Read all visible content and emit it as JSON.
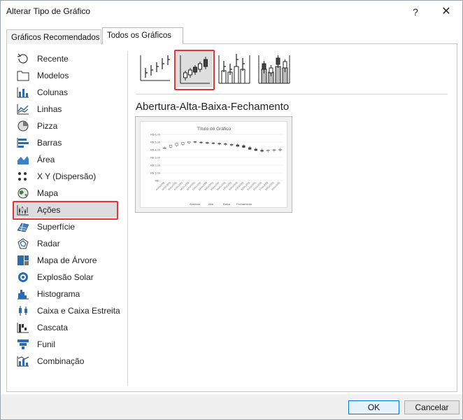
{
  "window": {
    "title": "Alterar Tipo de Gráfico",
    "help_label": "?",
    "close_label": "✕"
  },
  "tabs": [
    {
      "label": "Gráficos Recomendados",
      "active": false
    },
    {
      "label": "Todos os Gráficos",
      "active": true
    }
  ],
  "categories": [
    {
      "label": "Recente",
      "icon": "recent-icon"
    },
    {
      "label": "Modelos",
      "icon": "templates-icon"
    },
    {
      "label": "Colunas",
      "icon": "column-chart-icon"
    },
    {
      "label": "Linhas",
      "icon": "line-chart-icon"
    },
    {
      "label": "Pizza",
      "icon": "pie-chart-icon"
    },
    {
      "label": "Barras",
      "icon": "bar-chart-icon"
    },
    {
      "label": "Área",
      "icon": "area-chart-icon"
    },
    {
      "label": "X Y (Dispersão)",
      "icon": "scatter-chart-icon"
    },
    {
      "label": "Mapa",
      "icon": "map-chart-icon"
    },
    {
      "label": "Ações",
      "icon": "stock-chart-icon",
      "selected": true
    },
    {
      "label": "Superfície",
      "icon": "surface-chart-icon"
    },
    {
      "label": "Radar",
      "icon": "radar-chart-icon"
    },
    {
      "label": "Mapa de Árvore",
      "icon": "treemap-chart-icon"
    },
    {
      "label": "Explosão Solar",
      "icon": "sunburst-chart-icon"
    },
    {
      "label": "Histograma",
      "icon": "histogram-chart-icon"
    },
    {
      "label": "Caixa e Caixa Estreita",
      "icon": "box-whisker-chart-icon"
    },
    {
      "label": "Cascata",
      "icon": "waterfall-chart-icon"
    },
    {
      "label": "Funil",
      "icon": "funnel-chart-icon"
    },
    {
      "label": "Combinação",
      "icon": "combo-chart-icon"
    }
  ],
  "subtypes": [
    {
      "icon": "high-low-close-icon",
      "selected": false
    },
    {
      "icon": "open-high-low-close-icon",
      "selected": true
    },
    {
      "icon": "volume-high-low-close-icon",
      "selected": false
    },
    {
      "icon": "volume-open-high-low-close-icon",
      "selected": false
    }
  ],
  "selected_subtype_name": "Abertura-Alta-Baixa-Fechamento",
  "preview": {
    "chart_data": {
      "type": "candlestick",
      "title": "Título do Gráfico",
      "y_tick_labels": [
        "R$ 6,00",
        "R$ 5,00",
        "R$ 4,00",
        "R$ 3,00",
        "R$ 2,00",
        "R$ 1,00",
        "R$ -"
      ],
      "ylim": [
        0,
        6
      ],
      "categories": [
        "04/01/2021",
        "05/01/2021",
        "06/01/2021",
        "07/01/2021",
        "08/01/2021",
        "11/01/2021",
        "12/01/2021",
        "13/01/2021",
        "14/01/2021",
        "15/01/2021",
        "18/01/2021",
        "19/01/2021",
        "20/01/2021",
        "21/01/2021",
        "22/01/2021",
        "25/01/2021",
        "26/01/2021",
        "27/01/2021",
        "28/01/2021",
        "29/01/2021"
      ],
      "open": [
        4.2,
        4.35,
        4.55,
        4.7,
        4.9,
        5.05,
        5.0,
        4.95,
        4.9,
        4.85,
        4.8,
        4.7,
        4.65,
        4.55,
        4.3,
        4.1,
        3.95,
        3.85,
        3.95,
        4.0
      ],
      "high": [
        4.4,
        4.65,
        4.9,
        5.0,
        5.1,
        5.15,
        5.1,
        5.05,
        5.0,
        4.95,
        4.9,
        4.85,
        4.8,
        4.7,
        4.5,
        4.3,
        4.15,
        4.05,
        4.1,
        4.25
      ],
      "low": [
        4.1,
        4.2,
        4.4,
        4.55,
        4.75,
        4.85,
        4.8,
        4.75,
        4.7,
        4.6,
        4.55,
        4.45,
        4.35,
        4.25,
        4.0,
        3.85,
        3.7,
        3.65,
        3.75,
        3.8
      ],
      "close": [
        4.25,
        4.6,
        4.85,
        4.95,
        5.05,
        5.0,
        4.9,
        4.85,
        4.8,
        4.75,
        4.7,
        4.6,
        4.45,
        4.3,
        4.05,
        3.9,
        3.8,
        3.95,
        4.0,
        4.05
      ],
      "legend": [
        "Abertura",
        "Alta",
        "Baixa",
        "Fechamento"
      ],
      "legend_position": "bottom"
    }
  },
  "buttons": {
    "ok": "OK",
    "cancel": "Cancelar"
  },
  "colors": {
    "highlight": "#e0353b",
    "selected_bg": "#dcdcdc",
    "accent": "#0078d7"
  }
}
